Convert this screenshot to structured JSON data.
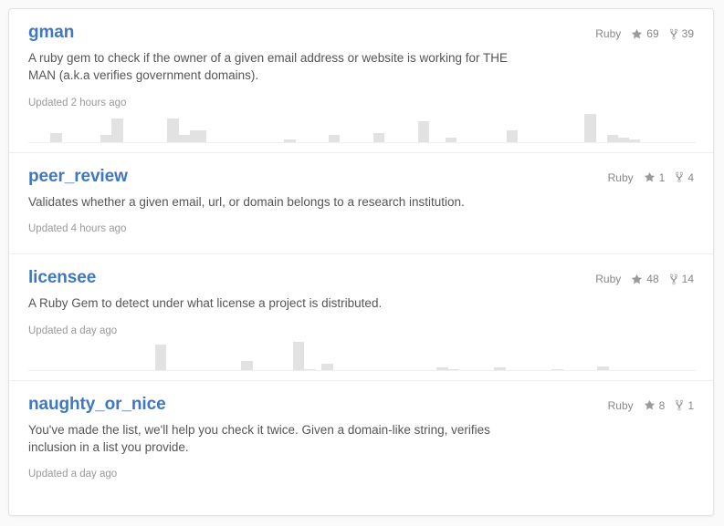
{
  "repos": [
    {
      "name": "gman",
      "language": "Ruby",
      "stars": "69",
      "forks": "39",
      "description": "A ruby gem to check if the owner of a given email address or website is working for THE MAN (a.k.a verifies government domains).",
      "updated": "Updated 2 hours ago",
      "has_sparkline": true,
      "sparkline": [
        0,
        0,
        0,
        0,
        4,
        4,
        0,
        0,
        0,
        0,
        0,
        0,
        0,
        3,
        3,
        10,
        10,
        0,
        0,
        0,
        0,
        0,
        0,
        0,
        0,
        10,
        10,
        3,
        3,
        5,
        5,
        5,
        0,
        0,
        0,
        0,
        0,
        0,
        0,
        0,
        0,
        0,
        0,
        0,
        0,
        0,
        1,
        1,
        0,
        0,
        0,
        0,
        0,
        0,
        3,
        3,
        0,
        0,
        0,
        0,
        0,
        0,
        4,
        4,
        0,
        0,
        0,
        0,
        0,
        0,
        9,
        9,
        0,
        0,
        0,
        2,
        2,
        0,
        0,
        0,
        0,
        0,
        0,
        0,
        0,
        0,
        5,
        5,
        0,
        0,
        0,
        0,
        0,
        0,
        0,
        0,
        0,
        0,
        0,
        0,
        12,
        12,
        0,
        0,
        3,
        3,
        2,
        2,
        1,
        1,
        0,
        0,
        0,
        0,
        0,
        0,
        0,
        0,
        0,
        0
      ]
    },
    {
      "name": "peer_review",
      "language": "Ruby",
      "stars": "1",
      "forks": "4",
      "description": "Validates whether a given email, url, or domain belongs to a research institution.",
      "updated": "Updated 4 hours ago",
      "has_sparkline": false,
      "sparkline": []
    },
    {
      "name": "licensee",
      "language": "Ruby",
      "stars": "48",
      "forks": "14",
      "description": "A Ruby Gem to detect under what license a project is distributed.",
      "updated": "Updated a day ago",
      "has_sparkline": true,
      "sparkline": [
        0,
        0,
        0,
        0,
        0,
        0,
        0,
        0,
        0,
        0,
        0,
        0,
        0,
        0,
        0,
        0,
        0,
        0,
        0,
        0,
        0,
        0,
        28,
        28,
        0,
        0,
        0,
        0,
        0,
        0,
        0,
        0,
        0,
        0,
        0,
        0,
        0,
        10,
        10,
        0,
        0,
        0,
        0,
        0,
        0,
        0,
        31,
        31,
        1,
        1,
        0,
        7,
        7,
        0,
        0,
        0,
        0,
        0,
        0,
        0,
        0,
        0,
        0,
        0,
        0,
        0,
        0,
        0,
        0,
        0,
        0,
        3,
        3,
        1,
        1,
        0,
        0,
        0,
        0,
        0,
        0,
        3,
        3,
        0,
        0,
        0,
        0,
        0,
        0,
        0,
        0,
        1,
        1,
        0,
        0,
        0,
        0,
        0,
        0,
        4,
        4,
        0,
        0,
        0,
        0,
        0,
        0,
        0,
        0,
        0,
        0,
        0,
        0,
        0,
        0,
        0
      ]
    },
    {
      "name": "naughty_or_nice",
      "language": "Ruby",
      "stars": "8",
      "forks": "1",
      "description": "You've made the list, we'll help you check it twice. Given a domain-like string, verifies inclusion in a list you provide.",
      "updated": "Updated a day ago",
      "has_sparkline": false,
      "sparkline": []
    }
  ],
  "icons": {
    "star": "star-icon",
    "fork": "repo-forked-icon"
  },
  "colors": {
    "link": "#4078c0",
    "text": "#555555",
    "muted": "#888888",
    "bar": "#e2e2e2"
  },
  "chart_data": [
    {
      "type": "bar",
      "title": "gman commit activity sparkline",
      "xlabel": "",
      "ylabel": "",
      "x": [
        1,
        2,
        3,
        4,
        5,
        6,
        7,
        8,
        9,
        10,
        11,
        12,
        13,
        14,
        15,
        16,
        17,
        18,
        19,
        20,
        21,
        22,
        23,
        24,
        25,
        26,
        27,
        28,
        29,
        30,
        31,
        32,
        33,
        34,
        35,
        36,
        37,
        38,
        39,
        40,
        41,
        42,
        43,
        44,
        45,
        46,
        47,
        48,
        49,
        50,
        51,
        52
      ],
      "values": [
        0,
        0,
        4,
        0,
        0,
        0,
        3,
        10,
        0,
        0,
        0,
        0,
        10,
        3,
        5,
        5,
        0,
        0,
        0,
        0,
        0,
        0,
        1,
        0,
        0,
        3,
        0,
        0,
        0,
        4,
        0,
        0,
        0,
        9,
        0,
        2,
        0,
        0,
        0,
        0,
        5,
        0,
        0,
        0,
        0,
        0,
        12,
        0,
        3,
        2,
        1,
        0
      ],
      "ylim": [
        0,
        12
      ],
      "grid": false,
      "legend": false
    },
    {
      "type": "bar",
      "title": "licensee commit activity sparkline",
      "xlabel": "",
      "ylabel": "",
      "x": [
        1,
        2,
        3,
        4,
        5,
        6,
        7,
        8,
        9,
        10,
        11,
        12,
        13,
        14,
        15,
        16,
        17,
        18,
        19,
        20,
        21,
        22,
        23,
        24,
        25,
        26,
        27,
        28,
        29,
        30,
        31,
        32,
        33,
        34,
        35,
        36,
        37,
        38,
        39,
        40,
        41,
        42,
        43,
        44,
        45,
        46,
        47,
        48,
        49,
        50,
        51,
        52
      ],
      "values": [
        0,
        0,
        0,
        0,
        0,
        0,
        0,
        0,
        0,
        0,
        28,
        0,
        0,
        0,
        0,
        0,
        0,
        10,
        0,
        0,
        0,
        0,
        31,
        1,
        7,
        0,
        0,
        0,
        0,
        0,
        0,
        0,
        0,
        0,
        3,
        1,
        0,
        0,
        0,
        3,
        0,
        0,
        0,
        1,
        0,
        0,
        0,
        4,
        0,
        0,
        0,
        0
      ],
      "ylim": [
        0,
        31
      ],
      "grid": false,
      "legend": false
    }
  ]
}
